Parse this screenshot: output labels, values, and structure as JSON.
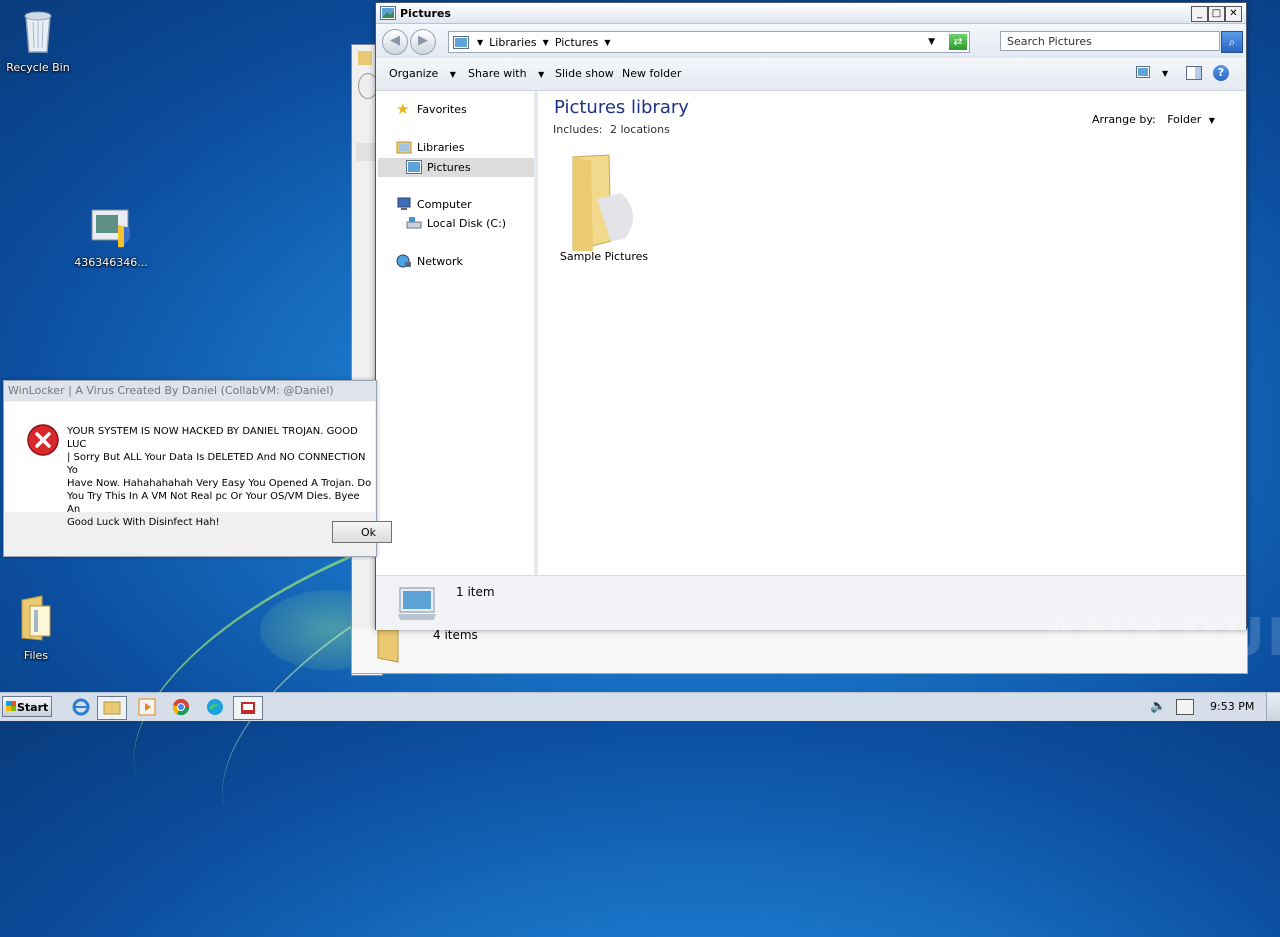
{
  "desktop": {
    "icons": [
      {
        "label": "Recycle Bin"
      },
      {
        "label": "436346346..."
      },
      {
        "label": "Files"
      }
    ]
  },
  "explorer": {
    "title": "Pictures",
    "address": {
      "segments": [
        "Libraries",
        "Pictures"
      ]
    },
    "search": {
      "placeholder": "Search Pictures"
    },
    "toolbar": {
      "organize": "Organize",
      "share_with": "Share with",
      "slide_show": "Slide show",
      "new_folder": "New folder"
    },
    "nav": {
      "favorites": "Favorites",
      "libraries": "Libraries",
      "pictures": "Pictures",
      "computer": "Computer",
      "local_disk": "Local Disk (C:)",
      "network": "Network"
    },
    "library": {
      "heading": "Pictures library",
      "includes_label": "Includes:",
      "includes_value": "2 locations",
      "arrange_label": "Arrange by:",
      "arrange_value": "Folder"
    },
    "items": [
      {
        "name": "Sample Pictures"
      }
    ],
    "status": "1 item"
  },
  "back_window": {
    "status": "4 items"
  },
  "dialog": {
    "title": "WinLocker | A Virus Created By Daniel (CollabVM: @Daniel)",
    "message": "YOUR SYSTEM IS NOW HACKED BY DANIEL TROJAN. GOOD LUC\n| Sorry But ALL Your Data Is DELETED And NO CONNECTION Yo\nHave Now. Hahahahahah Very Easy You Opened A Trojan. Do\nYou Try This In A VM Not Real pc Or  Your OS/VM Dies. Byee An\nGood Luck With Disinfect Hah!",
    "ok_label": "Ok"
  },
  "taskbar": {
    "start_label": "Start",
    "clock": "9:53 PM"
  },
  "watermark": "ANY.RUN"
}
